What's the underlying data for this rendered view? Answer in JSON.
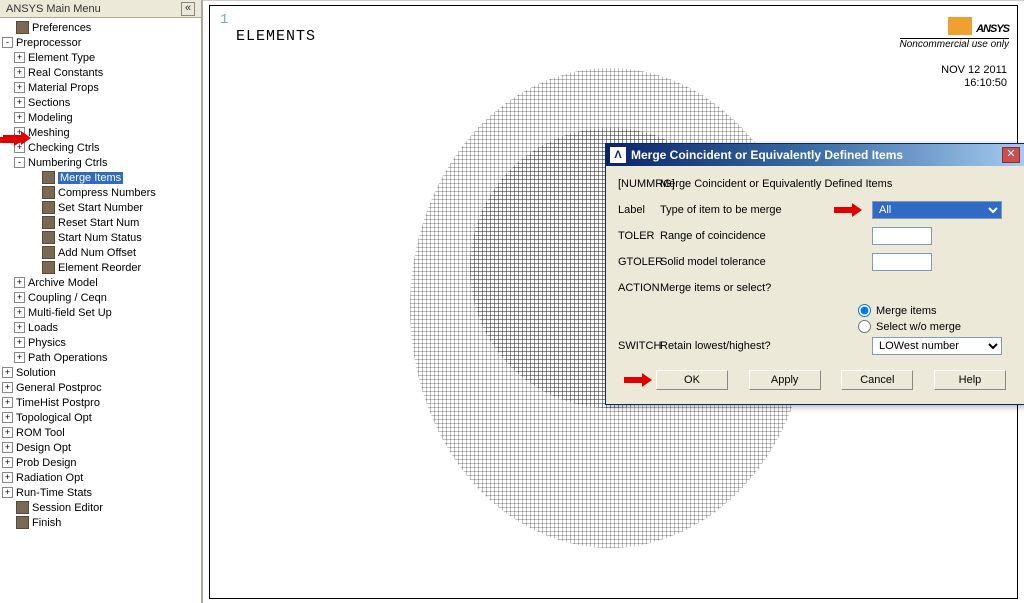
{
  "sidebar": {
    "title": "ANSYS Main Menu",
    "items": [
      {
        "indent": 0,
        "exp": "",
        "label": "Preferences",
        "sel": false,
        "icon": "grid"
      },
      {
        "indent": 0,
        "exp": "-",
        "label": "Preprocessor",
        "sel": false,
        "icon": ""
      },
      {
        "indent": 1,
        "exp": "+",
        "label": "Element Type",
        "sel": false,
        "icon": ""
      },
      {
        "indent": 1,
        "exp": "+",
        "label": "Real Constants",
        "sel": false,
        "icon": ""
      },
      {
        "indent": 1,
        "exp": "+",
        "label": "Material Props",
        "sel": false,
        "icon": ""
      },
      {
        "indent": 1,
        "exp": "+",
        "label": "Sections",
        "sel": false,
        "icon": ""
      },
      {
        "indent": 1,
        "exp": "+",
        "label": "Modeling",
        "sel": false,
        "icon": ""
      },
      {
        "indent": 1,
        "exp": "+",
        "label": "Meshing",
        "sel": false,
        "icon": ""
      },
      {
        "indent": 1,
        "exp": "+",
        "label": "Checking Ctrls",
        "sel": false,
        "icon": ""
      },
      {
        "indent": 1,
        "exp": "-",
        "label": "Numbering Ctrls",
        "sel": false,
        "icon": ""
      },
      {
        "indent": 2,
        "exp": "",
        "label": "Merge Items",
        "sel": true,
        "icon": "grid"
      },
      {
        "indent": 2,
        "exp": "",
        "label": "Compress Numbers",
        "sel": false,
        "icon": "grid"
      },
      {
        "indent": 2,
        "exp": "",
        "label": "Set Start Number",
        "sel": false,
        "icon": "grid"
      },
      {
        "indent": 2,
        "exp": "",
        "label": "Reset Start Num",
        "sel": false,
        "icon": "grid"
      },
      {
        "indent": 2,
        "exp": "",
        "label": "Start Num Status",
        "sel": false,
        "icon": "grid"
      },
      {
        "indent": 2,
        "exp": "",
        "label": "Add Num Offset",
        "sel": false,
        "icon": "grid"
      },
      {
        "indent": 2,
        "exp": "",
        "label": "Element Reorder",
        "sel": false,
        "icon": "grid"
      },
      {
        "indent": 1,
        "exp": "+",
        "label": "Archive Model",
        "sel": false,
        "icon": ""
      },
      {
        "indent": 1,
        "exp": "+",
        "label": "Coupling / Ceqn",
        "sel": false,
        "icon": ""
      },
      {
        "indent": 1,
        "exp": "+",
        "label": "Multi-field Set Up",
        "sel": false,
        "icon": ""
      },
      {
        "indent": 1,
        "exp": "+",
        "label": "Loads",
        "sel": false,
        "icon": ""
      },
      {
        "indent": 1,
        "exp": "+",
        "label": "Physics",
        "sel": false,
        "icon": ""
      },
      {
        "indent": 1,
        "exp": "+",
        "label": "Path Operations",
        "sel": false,
        "icon": ""
      },
      {
        "indent": 0,
        "exp": "+",
        "label": "Solution",
        "sel": false,
        "icon": ""
      },
      {
        "indent": 0,
        "exp": "+",
        "label": "General Postproc",
        "sel": false,
        "icon": ""
      },
      {
        "indent": 0,
        "exp": "+",
        "label": "TimeHist Postpro",
        "sel": false,
        "icon": ""
      },
      {
        "indent": 0,
        "exp": "+",
        "label": "Topological Opt",
        "sel": false,
        "icon": ""
      },
      {
        "indent": 0,
        "exp": "+",
        "label": "ROM Tool",
        "sel": false,
        "icon": ""
      },
      {
        "indent": 0,
        "exp": "+",
        "label": "Design Opt",
        "sel": false,
        "icon": ""
      },
      {
        "indent": 0,
        "exp": "+",
        "label": "Prob Design",
        "sel": false,
        "icon": ""
      },
      {
        "indent": 0,
        "exp": "+",
        "label": "Radiation Opt",
        "sel": false,
        "icon": ""
      },
      {
        "indent": 0,
        "exp": "+",
        "label": "Run-Time Stats",
        "sel": false,
        "icon": ""
      },
      {
        "indent": 0,
        "exp": "",
        "label": "Session Editor",
        "sel": false,
        "icon": "grid"
      },
      {
        "indent": 0,
        "exp": "",
        "label": "Finish",
        "sel": false,
        "icon": "grid"
      }
    ]
  },
  "viewport": {
    "tag": "1",
    "label": "ELEMENTS",
    "logo_text": "ANSYS",
    "logo_sub": "Noncommercial use only",
    "date": "NOV 12 2011",
    "time": "16:10:50"
  },
  "dialog": {
    "title": "Merge Coincident or Equivalently Defined Items",
    "desc_cmd": "[NUMMRG]",
    "desc_text": "Merge Coincident or Equivalently Defined Items",
    "rows": {
      "label_cmd": "Label",
      "label_text": "Type of item to be merge",
      "label_value": "All",
      "toler_cmd": "TOLER",
      "toler_text": "Range of coincidence",
      "toler_value": "",
      "gtoler_cmd": "GTOLER",
      "gtoler_text": "Solid model tolerance",
      "gtoler_value": "",
      "action_cmd": "ACTION",
      "action_text": "Merge items or select?",
      "radio1": "Merge items",
      "radio2": "Select w/o merge",
      "switch_cmd": "SWITCH",
      "switch_text": "Retain lowest/highest?",
      "switch_value": "LOWest number"
    },
    "buttons": {
      "ok": "OK",
      "apply": "Apply",
      "cancel": "Cancel",
      "help": "Help"
    }
  }
}
